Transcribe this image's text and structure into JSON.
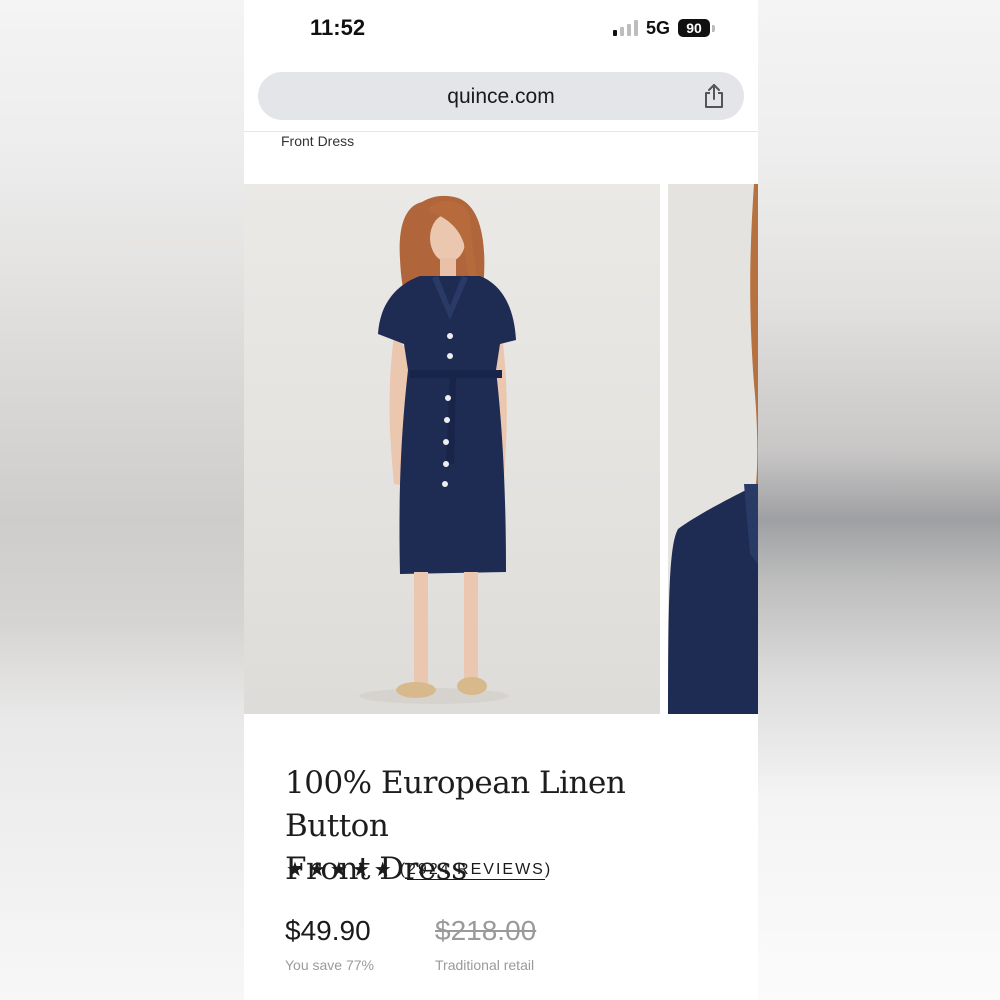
{
  "status_bar": {
    "time": "11:52",
    "network": "5G",
    "battery": "90"
  },
  "browser": {
    "url": "quince.com",
    "share_icon": "share-icon"
  },
  "breadcrumb": "Front Dress",
  "product": {
    "title_line1": "100% European Linen Button",
    "title_line2": "Front Dress",
    "rating": 5,
    "reviews_open": "(",
    "reviews_label": "2924 REVIEWS",
    "reviews_close": ")",
    "price": "$49.90",
    "savings": "You save 77%",
    "retail_price": "$218.00",
    "retail_label": "Traditional retail"
  },
  "colors": {
    "dress": "#1e2b52",
    "text": "#1b1b1b",
    "muted": "#9a9a9a"
  }
}
